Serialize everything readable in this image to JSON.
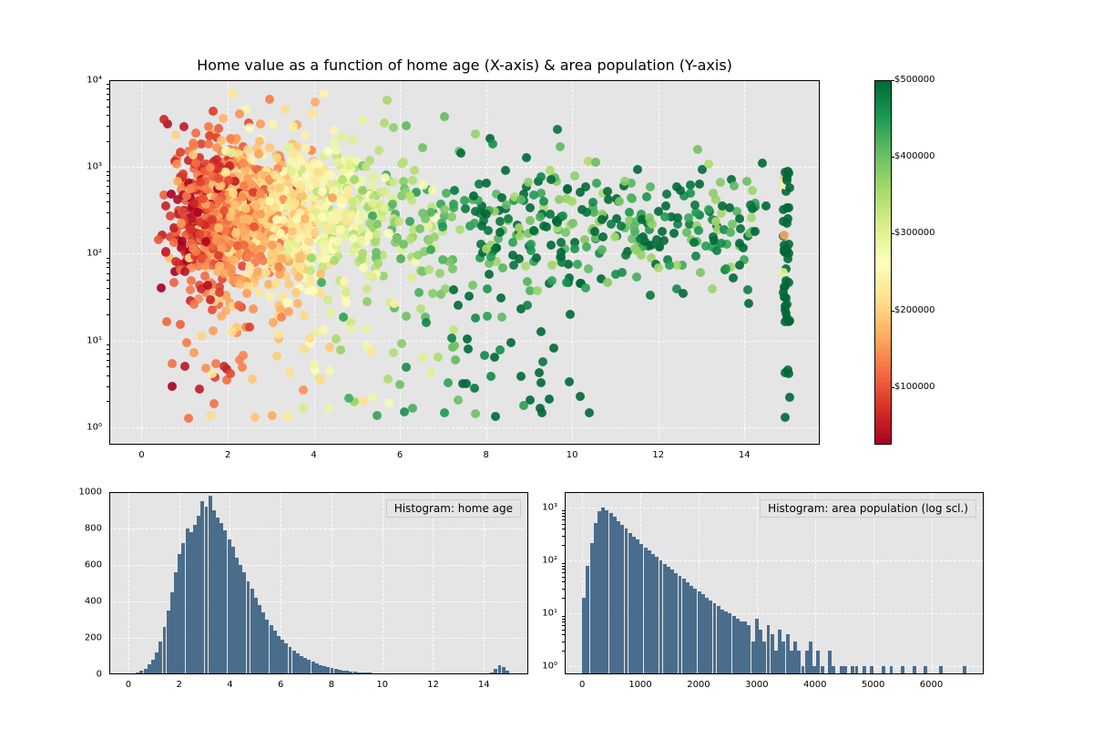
{
  "chart_data": [
    {
      "type": "scatter",
      "title": "Home value as a function of home age (X-axis) & area population (Y-axis)",
      "xlabel": "",
      "ylabel": "",
      "xlim": [
        -0.75,
        15.75
      ],
      "ylim_log10": [
        -0.2,
        4
      ],
      "yscale": "log",
      "x_ticks": [
        0,
        2,
        4,
        6,
        8,
        10,
        12,
        14
      ],
      "y_ticks_log10": [
        0,
        1,
        2,
        3,
        4
      ],
      "y_tick_labels": [
        "10⁰",
        "10¹",
        "10²",
        "10³",
        "10⁴"
      ],
      "colorbar": {
        "ticks": [
          100000,
          200000,
          300000,
          400000,
          500000
        ],
        "tick_labels": [
          "$100000",
          "$200000",
          "$300000",
          "$400000",
          "$500000"
        ],
        "vmin": 25000,
        "vmax": 500000,
        "cmap": "RdYlGn"
      },
      "note": "≈5000 points; point cloud dense at x≈1–5, y≈10²–10³; low-x points red (low home value), shifting through yellow ≈x=5 to green at higher x; vertical band of green points at x≈15."
    },
    {
      "type": "bar",
      "title": "Histogram: home age",
      "xlabel": "",
      "ylabel": "",
      "xlim": [
        -0.75,
        15.75
      ],
      "ylim": [
        0,
        1000
      ],
      "x_ticks": [
        0,
        2,
        4,
        6,
        8,
        10,
        12,
        14
      ],
      "y_ticks": [
        0,
        200,
        400,
        600,
        800,
        1000
      ],
      "n_bins": 100,
      "sample_counts": [
        2,
        5,
        10,
        18,
        30,
        55,
        80,
        120,
        180,
        260,
        350,
        450,
        560,
        660,
        720,
        800,
        780,
        820,
        870,
        950,
        920,
        980,
        900,
        860,
        830,
        790,
        740,
        700,
        640,
        600,
        560,
        510,
        470,
        420,
        380,
        340,
        300,
        270,
        240,
        210,
        190,
        170,
        150,
        130,
        115,
        100,
        90,
        78,
        68,
        58,
        50,
        44,
        38,
        33,
        28,
        24,
        21,
        18,
        16,
        14,
        12,
        11,
        10,
        8,
        7,
        6,
        6,
        5,
        5,
        4,
        4,
        3,
        3,
        3,
        2,
        2,
        2,
        2,
        2,
        1,
        1,
        1,
        1,
        1,
        1,
        1,
        1,
        1,
        0,
        0,
        0,
        0,
        0,
        0,
        0,
        12,
        30,
        50,
        40,
        20
      ]
    },
    {
      "type": "bar",
      "title": "Histogram: area population (log scl.)",
      "xlabel": "",
      "ylabel": "",
      "yscale": "log",
      "xlim": [
        -300,
        6900
      ],
      "ylim_log10": [
        -0.15,
        3.3
      ],
      "x_ticks": [
        0,
        1000,
        2000,
        3000,
        4000,
        5000,
        6000
      ],
      "y_ticks_log10": [
        0,
        1,
        2,
        3
      ],
      "y_tick_labels": [
        "10⁰",
        "10¹",
        "10²",
        "10³"
      ],
      "n_bins": 100,
      "sample_counts": [
        20,
        80,
        220,
        520,
        850,
        1000,
        920,
        800,
        680,
        570,
        480,
        400,
        340,
        290,
        250,
        210,
        180,
        155,
        135,
        118,
        100,
        88,
        77,
        67,
        58,
        51,
        45,
        39,
        34,
        30,
        26,
        23,
        20,
        18,
        16,
        14,
        12,
        11,
        10,
        9,
        8,
        7,
        7,
        6,
        3,
        8,
        5,
        3,
        6,
        4,
        2,
        5,
        3,
        4,
        2,
        3,
        2,
        1,
        2,
        3,
        1,
        2,
        1,
        0,
        2,
        1,
        0,
        1,
        1,
        0,
        1,
        1,
        0,
        1,
        0,
        1,
        0,
        0,
        1,
        0,
        1,
        0,
        0,
        1,
        0,
        0,
        1,
        0,
        0,
        1,
        0,
        0,
        0,
        1,
        0,
        0,
        0,
        0,
        0,
        1
      ]
    }
  ],
  "scatter_title": "Home value as a function of home age (X-axis) & area population (Y-axis)",
  "hist1_title": "Histogram: home age",
  "hist2_title": "Histogram: area population (log scl.)",
  "cbar_labels": [
    "$100000",
    "$200000",
    "$300000",
    "$400000",
    "$500000"
  ],
  "scatter_xticks": [
    "0",
    "2",
    "4",
    "6",
    "8",
    "10",
    "12",
    "14"
  ],
  "scatter_yticks": [
    "10⁰",
    "10¹",
    "10²",
    "10³",
    "10⁴"
  ],
  "h1_xticks": [
    "0",
    "2",
    "4",
    "6",
    "8",
    "10",
    "12",
    "14"
  ],
  "h1_yticks": [
    "0",
    "200",
    "400",
    "600",
    "800",
    "1000"
  ],
  "h2_xticks": [
    "0",
    "1000",
    "2000",
    "3000",
    "4000",
    "5000",
    "6000"
  ],
  "h2_yticks": [
    "10⁰",
    "10¹",
    "10²",
    "10³"
  ]
}
